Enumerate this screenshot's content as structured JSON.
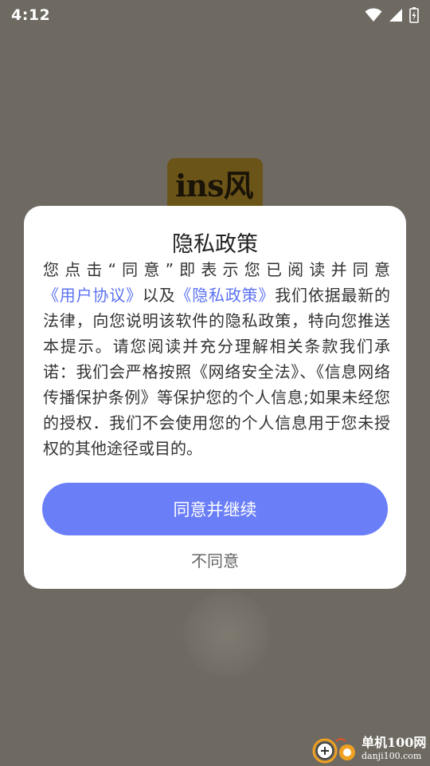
{
  "status_bar": {
    "time": "4:12",
    "icons": [
      "wifi-icon",
      "signal-icon",
      "battery-charging-icon"
    ]
  },
  "background": {
    "app_logo_text": "ins风"
  },
  "dialog": {
    "title": "隐私政策",
    "body": {
      "part1": "您点击“同意”即表示您已阅读并同意",
      "link_user_agreement": "《用户协议》",
      "part2": "以及",
      "link_privacy_policy": "《隐私政策》",
      "part3": "我们依据最新的法律，向您说明该软件的隐私政策，特向您推送本提示。请您阅读并充分理解相关条款我们承诺：我们会严格按照《网络安全法》、《信息网络传播保护条例》等保护您的个人信息;如果未经您的授权．我们不会使用您的个人信息用于您未授权的其他途径或目的。"
    },
    "agree_label": "同意并继续",
    "disagree_label": "不同意"
  },
  "watermark": {
    "name": "单机100网",
    "url": "danji100.com"
  },
  "colors": {
    "accent": "#6a7ef8",
    "link": "#5b72f2",
    "overlay": "#6e6a62"
  }
}
